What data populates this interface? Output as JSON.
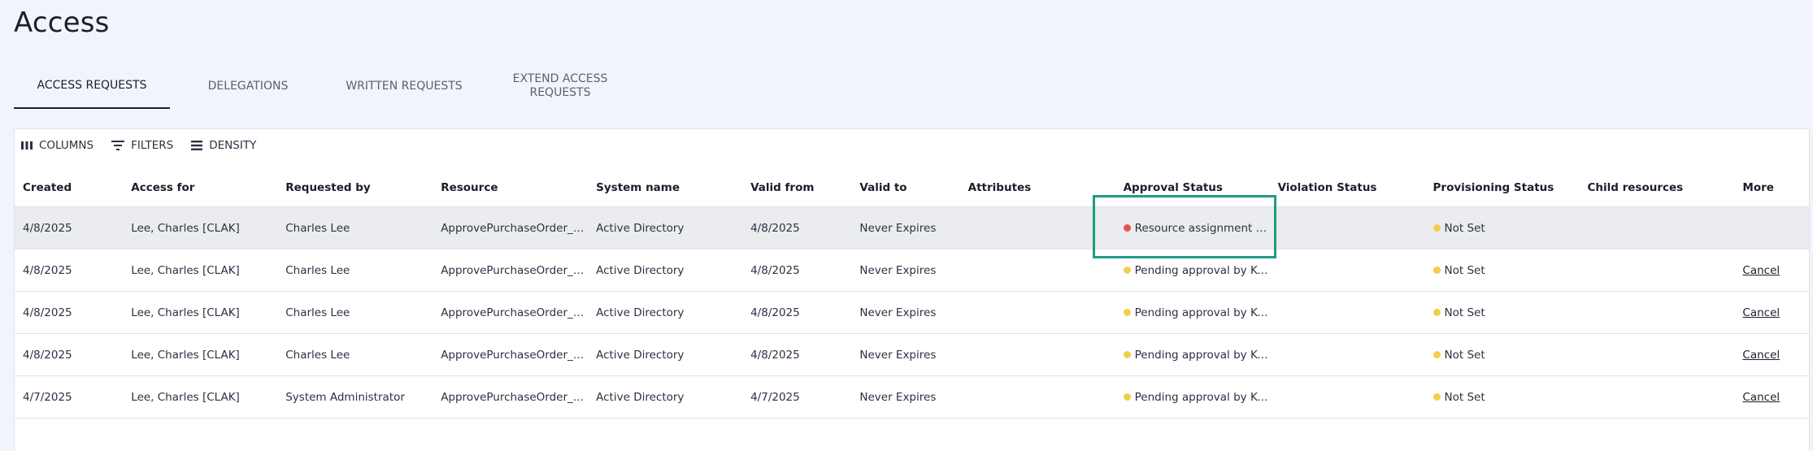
{
  "page": {
    "title": "Access"
  },
  "tabs": [
    {
      "label": "ACCESS REQUESTS",
      "active": true
    },
    {
      "label": "DELEGATIONS",
      "active": false
    },
    {
      "label": "WRITTEN REQUESTS",
      "active": false
    },
    {
      "label": "EXTEND ACCESS REQUESTS",
      "active": false
    }
  ],
  "toolbar": {
    "columns_label": "COLUMNS",
    "filters_label": "FILTERS",
    "density_label": "DENSITY"
  },
  "table": {
    "columns": [
      "Created",
      "Access for",
      "Requested by",
      "Resource",
      "System name",
      "Valid from",
      "Valid to",
      "Attributes",
      "Approval Status",
      "Violation Status",
      "Provisioning Status",
      "Child resources",
      "More"
    ],
    "rows": [
      {
        "created": "4/8/2025",
        "access_for": "Lee, Charles [CLAK]",
        "requested_by": "Charles Lee",
        "resource": "ApprovePurchaseOrder_C...",
        "system_name": "Active Directory",
        "valid_from": "4/8/2025",
        "valid_to": "Never Expires",
        "attributes": "",
        "approval_status": "Resource assignment is ...",
        "approval_color": "#e8524a",
        "violation_status": "",
        "provisioning_status": "Not Set",
        "provisioning_color": "#f2cf4a",
        "child_resources": "",
        "more": "",
        "selected": true
      },
      {
        "created": "4/8/2025",
        "access_for": "Lee, Charles [CLAK]",
        "requested_by": "Charles Lee",
        "resource": "ApprovePurchaseOrder_C...",
        "system_name": "Active Directory",
        "valid_from": "4/8/2025",
        "valid_to": "Never Expires",
        "attributes": "",
        "approval_status": "Pending approval by Ke...",
        "approval_color": "#f2cf4a",
        "violation_status": "",
        "provisioning_status": "Not Set",
        "provisioning_color": "#f2cf4a",
        "child_resources": "",
        "more": "Cancel",
        "selected": false
      },
      {
        "created": "4/8/2025",
        "access_for": "Lee, Charles [CLAK]",
        "requested_by": "Charles Lee",
        "resource": "ApprovePurchaseOrder_C...",
        "system_name": "Active Directory",
        "valid_from": "4/8/2025",
        "valid_to": "Never Expires",
        "attributes": "",
        "approval_status": "Pending approval by Ke...",
        "approval_color": "#f2cf4a",
        "violation_status": "",
        "provisioning_status": "Not Set",
        "provisioning_color": "#f2cf4a",
        "child_resources": "",
        "more": "Cancel",
        "selected": false
      },
      {
        "created": "4/8/2025",
        "access_for": "Lee, Charles [CLAK]",
        "requested_by": "Charles Lee",
        "resource": "ApprovePurchaseOrder_C...",
        "system_name": "Active Directory",
        "valid_from": "4/8/2025",
        "valid_to": "Never Expires",
        "attributes": "",
        "approval_status": "Pending approval by Ke...",
        "approval_color": "#f2cf4a",
        "violation_status": "",
        "provisioning_status": "Not Set",
        "provisioning_color": "#f2cf4a",
        "child_resources": "",
        "more": "Cancel",
        "selected": false
      },
      {
        "created": "4/7/2025",
        "access_for": "Lee, Charles [CLAK]",
        "requested_by": "System Administrator",
        "resource": "ApprovePurchaseOrder_C...",
        "system_name": "Active Directory",
        "valid_from": "4/7/2025",
        "valid_to": "Never Expires",
        "attributes": "",
        "approval_status": "Pending approval by Ke...",
        "approval_color": "#f2cf4a",
        "violation_status": "",
        "provisioning_status": "Not Set",
        "provisioning_color": "#f2cf4a",
        "child_resources": "",
        "more": "Cancel",
        "selected": false
      }
    ]
  },
  "colors": {
    "highlight": "#1e9b84",
    "status_error": "#e8524a",
    "status_pending": "#f2cf4a"
  }
}
